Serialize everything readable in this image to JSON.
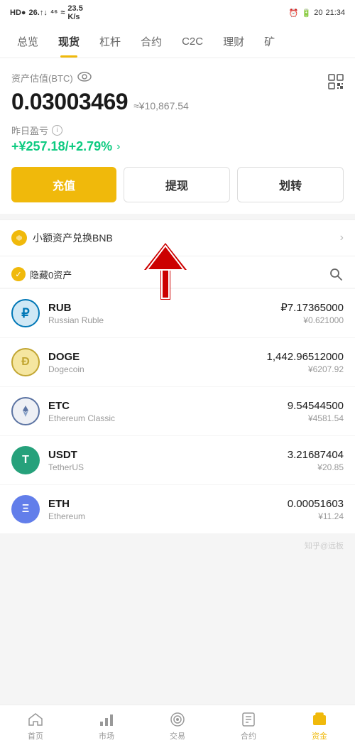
{
  "statusBar": {
    "left": "HD● 26.↑↓46 ≈ 23.5 K/s",
    "signals": "HD● 26 46",
    "speed": "23.5 K/s",
    "rightIcons": "🔔 📷 20 ▌21:34",
    "time": "21:34",
    "battery": "20"
  },
  "navTabs": [
    {
      "id": "overview",
      "label": "总览",
      "active": false
    },
    {
      "id": "spot",
      "label": "现货",
      "active": true
    },
    {
      "id": "leverage",
      "label": "杠杆",
      "active": false
    },
    {
      "id": "contract",
      "label": "合约",
      "active": false
    },
    {
      "id": "c2c",
      "label": "C2C",
      "active": false
    },
    {
      "id": "finance",
      "label": "理财",
      "active": false
    },
    {
      "id": "mining",
      "label": "矿",
      "active": false
    }
  ],
  "assetValuation": {
    "label": "资产估值(BTC)",
    "btcAmount": "0.03003469",
    "cnyApprox": "≈¥10,867.54",
    "yesterdayLabel": "昨日盈亏",
    "pnlValue": "+¥257.18/+2.79%",
    "arrowSymbol": ">"
  },
  "actionButtons": {
    "deposit": "充值",
    "withdraw": "提现",
    "transfer": "划转"
  },
  "convertBanner": {
    "icon": "✦",
    "text": "小额资产兑换BNB",
    "arrow": "›"
  },
  "assetListHeader": {
    "hideZero": "隐藏0资产",
    "checkmark": "✓"
  },
  "assets": [
    {
      "id": "rub",
      "symbol": "RUB",
      "fullname": "Russian Ruble",
      "amount": "₽7.17365000",
      "cny": "¥0.621000",
      "iconColor": "#0077B6",
      "iconBg": "#d0e8f5",
      "iconText": "₽"
    },
    {
      "id": "doge",
      "symbol": "DOGE",
      "fullname": "Dogecoin",
      "amount": "1,442.96512000",
      "cny": "¥6207.92",
      "iconColor": "#c2a633",
      "iconBg": "#f5e6a0",
      "iconText": "Ð"
    },
    {
      "id": "etc",
      "symbol": "ETC",
      "fullname": "Ethereum Classic",
      "amount": "9.54544500",
      "cny": "¥4581.54",
      "iconColor": "#5c74a3",
      "iconBg": "#eef0f5",
      "iconText": "◆"
    },
    {
      "id": "usdt",
      "symbol": "USDT",
      "fullname": "TetherUS",
      "amount": "3.21687404",
      "cny": "¥20.85",
      "iconColor": "#ffffff",
      "iconBg": "#26a17b",
      "iconText": "T"
    },
    {
      "id": "eth",
      "symbol": "ETH",
      "fullname": "Ethereum",
      "amount": "0.00051603",
      "cny": "¥11.24",
      "iconColor": "#ffffff",
      "iconBg": "#627eea",
      "iconText": "Ξ"
    }
  ],
  "bottomNav": [
    {
      "id": "home",
      "label": "首页",
      "active": false,
      "icon": "home"
    },
    {
      "id": "market",
      "label": "市场",
      "active": false,
      "icon": "chart"
    },
    {
      "id": "trade",
      "label": "交易",
      "active": false,
      "icon": "trade"
    },
    {
      "id": "contract",
      "label": "合约",
      "active": false,
      "icon": "contract"
    },
    {
      "id": "assets",
      "label": "资金",
      "active": true,
      "icon": "wallet"
    }
  ]
}
